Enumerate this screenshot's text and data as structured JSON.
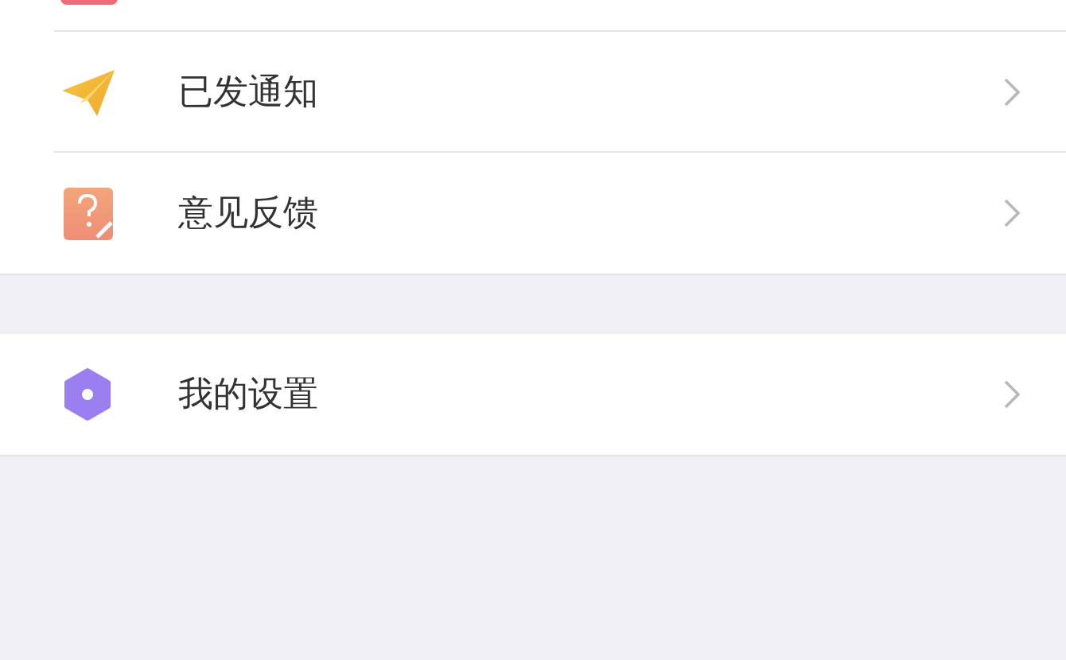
{
  "groups": [
    {
      "clipped_top": true,
      "items": [
        {
          "label": "已发通知"
        },
        {
          "label": "意见反馈"
        }
      ]
    },
    {
      "clipped_top": false,
      "items": [
        {
          "label": "我的设置"
        }
      ]
    }
  ]
}
